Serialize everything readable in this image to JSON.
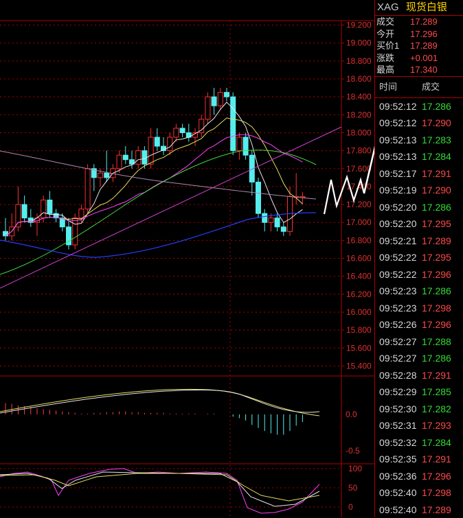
{
  "symbol": "XAG",
  "name": "现货白银",
  "quote": [
    {
      "label": "成交",
      "value": "17.289"
    },
    {
      "label": "今开",
      "value": "17.296"
    },
    {
      "label": "买价1",
      "value": "17.289"
    },
    {
      "label": "涨跌",
      "value": "+0.001"
    },
    {
      "label": "最高",
      "value": "17.340"
    }
  ],
  "trades_header": {
    "time": "时间",
    "price": "成交"
  },
  "trades": [
    {
      "time": "09:52:12",
      "price": "17.286",
      "dir": "dn"
    },
    {
      "time": "09:52:12",
      "price": "17.290",
      "dir": "up"
    },
    {
      "time": "09:52:13",
      "price": "17.283",
      "dir": "dn"
    },
    {
      "time": "09:52:13",
      "price": "17.284",
      "dir": "dn"
    },
    {
      "time": "09:52:17",
      "price": "17.291",
      "dir": "up"
    },
    {
      "time": "09:52:19",
      "price": "17.290",
      "dir": "up"
    },
    {
      "time": "09:52:20",
      "price": "17.286",
      "dir": "dn"
    },
    {
      "time": "09:52:20",
      "price": "17.295",
      "dir": "up"
    },
    {
      "time": "09:52:21",
      "price": "17.289",
      "dir": "up"
    },
    {
      "time": "09:52:22",
      "price": "17.295",
      "dir": "up"
    },
    {
      "time": "09:52:22",
      "price": "17.296",
      "dir": "up"
    },
    {
      "time": "09:52:23",
      "price": "17.286",
      "dir": "dn"
    },
    {
      "time": "09:52:23",
      "price": "17.298",
      "dir": "up"
    },
    {
      "time": "09:52:26",
      "price": "17.296",
      "dir": "up"
    },
    {
      "time": "09:52:27",
      "price": "17.288",
      "dir": "dn"
    },
    {
      "time": "09:52:27",
      "price": "17.286",
      "dir": "dn"
    },
    {
      "time": "09:52:28",
      "price": "17.291",
      "dir": "up"
    },
    {
      "time": "09:52:29",
      "price": "17.285",
      "dir": "dn"
    },
    {
      "time": "09:52:30",
      "price": "17.282",
      "dir": "dn"
    },
    {
      "time": "09:52:31",
      "price": "17.293",
      "dir": "up"
    },
    {
      "time": "09:52:32",
      "price": "17.284",
      "dir": "dn"
    },
    {
      "time": "09:52:35",
      "price": "17.291",
      "dir": "up"
    },
    {
      "time": "09:52:36",
      "price": "17.296",
      "dir": "up"
    },
    {
      "time": "09:52:40",
      "price": "17.298",
      "dir": "up"
    },
    {
      "time": "09:52:40",
      "price": "17.289",
      "dir": "up"
    }
  ],
  "colors": {
    "up": "#ff4a4a",
    "down": "#33dd33",
    "grid": "#b00000",
    "bull_candle": "#ff3030",
    "bear_candle": "#55eeee"
  },
  "chart_data": [
    {
      "type": "candlestick",
      "y_ticks": [
        "19.200",
        "19.000",
        "18.800",
        "18.600",
        "18.400",
        "18.200",
        "18.000",
        "17.800",
        "17.600",
        "17.400",
        "17.200",
        "17.000",
        "16.800",
        "16.600",
        "16.400",
        "16.200",
        "16.000",
        "15.800",
        "15.600",
        "15.400"
      ],
      "ylim": [
        15.35,
        19.3
      ],
      "candles": [
        {
          "o": 16.9,
          "h": 17.05,
          "l": 16.8,
          "c": 16.85
        },
        {
          "o": 16.85,
          "h": 17.1,
          "l": 16.8,
          "c": 16.95
        },
        {
          "o": 16.95,
          "h": 17.4,
          "l": 16.9,
          "c": 17.2
        },
        {
          "o": 17.2,
          "h": 17.3,
          "l": 17.0,
          "c": 17.05
        },
        {
          "o": 17.05,
          "h": 17.15,
          "l": 16.95,
          "c": 17.0
        },
        {
          "o": 17.0,
          "h": 17.1,
          "l": 16.85,
          "c": 17.05
        },
        {
          "o": 17.05,
          "h": 17.3,
          "l": 17.0,
          "c": 17.25
        },
        {
          "o": 17.25,
          "h": 17.35,
          "l": 17.05,
          "c": 17.1
        },
        {
          "o": 17.1,
          "h": 17.15,
          "l": 17.0,
          "c": 17.05
        },
        {
          "o": 17.05,
          "h": 17.1,
          "l": 16.9,
          "c": 16.95
        },
        {
          "o": 16.95,
          "h": 17.05,
          "l": 16.7,
          "c": 16.75
        },
        {
          "o": 16.75,
          "h": 17.1,
          "l": 16.7,
          "c": 17.05
        },
        {
          "o": 17.05,
          "h": 17.2,
          "l": 17.0,
          "c": 17.15
        },
        {
          "o": 17.15,
          "h": 17.65,
          "l": 17.1,
          "c": 17.6
        },
        {
          "o": 17.6,
          "h": 17.65,
          "l": 17.35,
          "c": 17.5
        },
        {
          "o": 17.5,
          "h": 17.6,
          "l": 17.4,
          "c": 17.55
        },
        {
          "o": 17.55,
          "h": 17.8,
          "l": 17.45,
          "c": 17.5
        },
        {
          "o": 17.5,
          "h": 17.65,
          "l": 17.45,
          "c": 17.6
        },
        {
          "o": 17.6,
          "h": 17.8,
          "l": 17.55,
          "c": 17.75
        },
        {
          "o": 17.75,
          "h": 17.85,
          "l": 17.65,
          "c": 17.7
        },
        {
          "o": 17.7,
          "h": 17.8,
          "l": 17.6,
          "c": 17.65
        },
        {
          "o": 17.65,
          "h": 17.85,
          "l": 17.6,
          "c": 17.8
        },
        {
          "o": 17.8,
          "h": 17.85,
          "l": 17.6,
          "c": 17.65
        },
        {
          "o": 17.65,
          "h": 18.05,
          "l": 17.6,
          "c": 17.95
        },
        {
          "o": 17.95,
          "h": 18.05,
          "l": 17.8,
          "c": 17.85
        },
        {
          "o": 17.85,
          "h": 17.95,
          "l": 17.75,
          "c": 17.8
        },
        {
          "o": 17.8,
          "h": 18.0,
          "l": 17.75,
          "c": 17.95
        },
        {
          "o": 17.95,
          "h": 18.1,
          "l": 17.9,
          "c": 18.05
        },
        {
          "o": 18.05,
          "h": 18.1,
          "l": 17.95,
          "c": 18.0
        },
        {
          "o": 18.0,
          "h": 18.1,
          "l": 17.9,
          "c": 17.95
        },
        {
          "o": 17.95,
          "h": 18.05,
          "l": 17.85,
          "c": 18.0
        },
        {
          "o": 18.0,
          "h": 18.2,
          "l": 17.95,
          "c": 18.15
        },
        {
          "o": 18.15,
          "h": 18.45,
          "l": 18.1,
          "c": 18.4
        },
        {
          "o": 18.4,
          "h": 18.5,
          "l": 18.2,
          "c": 18.3
        },
        {
          "o": 18.3,
          "h": 18.5,
          "l": 18.25,
          "c": 18.45
        },
        {
          "o": 18.45,
          "h": 18.5,
          "l": 18.35,
          "c": 18.4
        },
        {
          "o": 18.4,
          "h": 18.45,
          "l": 17.75,
          "c": 17.8
        },
        {
          "o": 17.8,
          "h": 18.0,
          "l": 17.7,
          "c": 17.95
        },
        {
          "o": 17.95,
          "h": 18.0,
          "l": 17.7,
          "c": 17.75
        },
        {
          "o": 17.75,
          "h": 17.8,
          "l": 17.3,
          "c": 17.45
        },
        {
          "o": 17.45,
          "h": 17.5,
          "l": 17.05,
          "c": 17.1
        },
        {
          "o": 17.1,
          "h": 17.15,
          "l": 16.9,
          "c": 17.0
        },
        {
          "o": 17.0,
          "h": 17.1,
          "l": 16.9,
          "c": 17.05
        },
        {
          "o": 17.05,
          "h": 17.1,
          "l": 16.9,
          "c": 16.95
        },
        {
          "o": 16.95,
          "h": 17.0,
          "l": 16.85,
          "c": 16.9
        },
        {
          "o": 16.9,
          "h": 17.4,
          "l": 16.85,
          "c": 17.29
        },
        {
          "o": 17.29,
          "h": 17.55,
          "l": 17.2,
          "c": 17.29
        },
        {
          "o": 17.29,
          "h": 17.34,
          "l": 17.2,
          "c": 17.29
        }
      ]
    },
    {
      "type": "histogram",
      "y_ticks": [
        "0.0",
        "-0.5"
      ],
      "values": [
        0.15,
        0.14,
        0.12,
        0.11,
        0.1,
        0.08,
        0.07,
        0.06,
        0.05,
        0.04,
        0.03,
        0.02,
        0.01,
        0.01,
        0.02,
        0.02,
        0.03,
        0.03,
        0.04,
        0.04,
        0.03,
        0.03,
        0.02,
        0.02,
        0.02,
        0.02,
        0.01,
        0.01,
        0.01,
        0.01,
        0.01,
        0.0,
        0.01,
        0.01,
        0.0,
        0.0,
        -0.03,
        -0.05,
        -0.08,
        -0.14,
        -0.18,
        -0.22,
        -0.25,
        -0.27,
        -0.27,
        -0.22,
        -0.15,
        -0.1
      ]
    },
    {
      "type": "line",
      "y_ticks": [
        "100",
        "50",
        "0"
      ]
    }
  ]
}
